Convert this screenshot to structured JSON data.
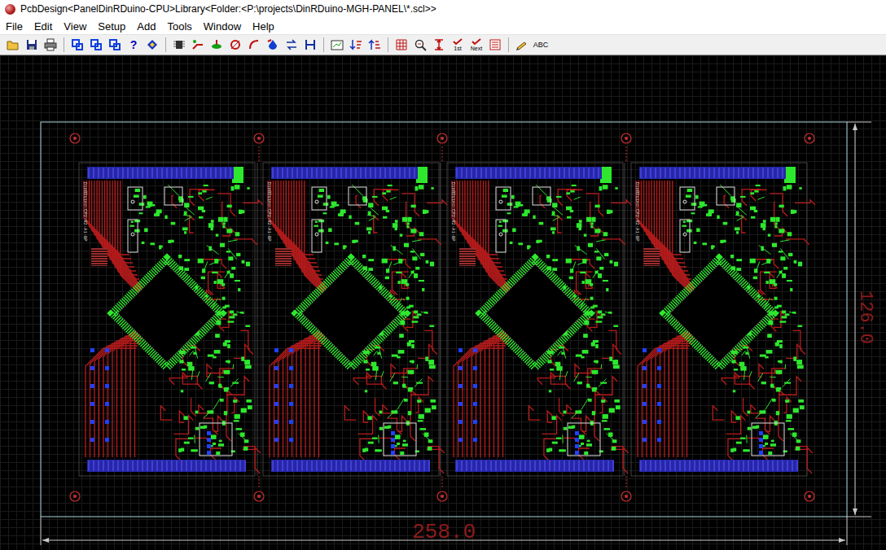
{
  "window": {
    "title": "PcbDesign<PanelDinRDuino-CPU>Library<Folder:<P:\\projects\\DinRDuino-MGH-PANEL\\*.scl>>"
  },
  "menu": [
    "File",
    "Edit",
    "View",
    "Setup",
    "Add",
    "Tools",
    "Window",
    "Help"
  ],
  "toolbar": [
    {
      "kind": "open"
    },
    {
      "kind": "save"
    },
    {
      "kind": "print"
    },
    {
      "kind": "sep"
    },
    {
      "kind": "sel1"
    },
    {
      "kind": "sel2"
    },
    {
      "kind": "sel3"
    },
    {
      "kind": "help",
      "label": "?"
    },
    {
      "kind": "mark"
    },
    {
      "kind": "sep"
    },
    {
      "kind": "chip"
    },
    {
      "kind": "route"
    },
    {
      "kind": "plane"
    },
    {
      "kind": "via"
    },
    {
      "kind": "arc"
    },
    {
      "kind": "fill"
    },
    {
      "kind": "swap"
    },
    {
      "kind": "ref"
    },
    {
      "kind": "sep"
    },
    {
      "kind": "zoomrect"
    },
    {
      "kind": "sortdown"
    },
    {
      "kind": "sortup"
    },
    {
      "kind": "sep"
    },
    {
      "kind": "drc"
    },
    {
      "kind": "zoomerr"
    },
    {
      "kind": "measure"
    },
    {
      "kind": "first",
      "label": "1st"
    },
    {
      "kind": "next",
      "label": "Next"
    },
    {
      "kind": "report"
    },
    {
      "kind": "sep"
    },
    {
      "kind": "pen"
    },
    {
      "kind": "text",
      "label": "ABC"
    }
  ],
  "panel": {
    "width": "258.0",
    "height": "126.0",
    "boards": [
      {
        "label": "DinRDuino-CPU-R2-A1-BP"
      },
      {
        "label": "DinRDuino-CPU-R2-A1-BP"
      },
      {
        "label": "DinRDuino-CPU-R2-A1-BP"
      },
      {
        "label": "DinRDuino-CPU-R2-A1-BP"
      }
    ]
  }
}
